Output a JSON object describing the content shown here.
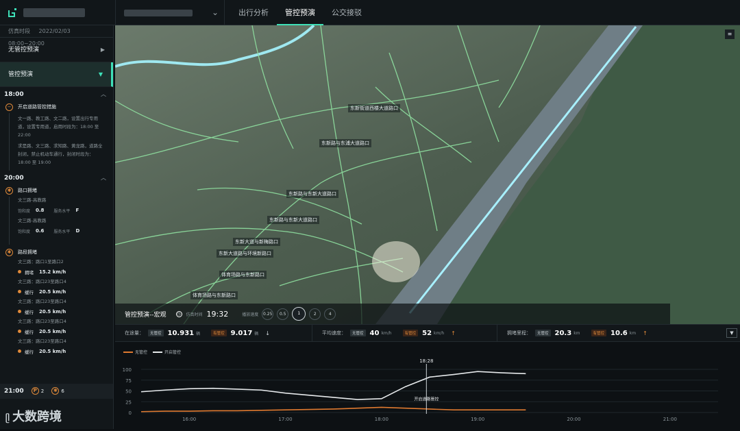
{
  "header": {
    "tabs": [
      {
        "label": "出行分析",
        "active": false
      },
      {
        "label": "管控预演",
        "active": true
      },
      {
        "label": "公交接驳",
        "active": false
      }
    ]
  },
  "sidebar": {
    "sim_label": "仿真时段",
    "sim_date": "2022/02/03",
    "sim_range": "08:00~20:00",
    "sections": [
      {
        "label": "无管控预演",
        "active": false
      },
      {
        "label": "管控预演",
        "active": true
      }
    ],
    "groups": [
      {
        "time": "18:00",
        "events": [
          {
            "title": "开启道路管控措施",
            "descs": [
              "文一路、教工路、文二路，设置出行专用道，设置专用道，启用时段为：18:00 至 22:00",
              "求是路、文三路、求知路、黄龙路，道路全封闭，禁止机动车通行，封闭时段为：18:00 至 19:00"
            ]
          }
        ]
      },
      {
        "time": "20:00",
        "junction": {
          "title": "路口拥堵",
          "rows": [
            {
              "name": "文三路-高教路",
              "k1": "饱和度",
              "v1": "0.8",
              "k2": "服务水平",
              "v2": "F"
            },
            {
              "name": "文三路-高教路",
              "k1": "饱和度",
              "v1": "0.6",
              "k2": "服务水平",
              "v2": "D"
            }
          ]
        },
        "road": {
          "title": "路段拥堵",
          "rows": [
            {
              "name": "文三路：路口1至路口2",
              "status": "拥堵",
              "speed": "15.2 km/h"
            },
            {
              "name": "文三路：路口23至路口4",
              "status": "缓行",
              "speed": "20.5 km/h"
            },
            {
              "name": "文三路：路口23至路口4",
              "status": "缓行",
              "speed": "20.5 km/h"
            },
            {
              "name": "文三路：路口23至路口4",
              "status": "缓行",
              "speed": "20.5 km/h"
            },
            {
              "name": "文三路：路口23至路口4",
              "status": "缓行",
              "speed": "20.5 km/h"
            }
          ]
        }
      }
    ],
    "bottom": {
      "time": "21:00",
      "b1": "2",
      "b2": "6"
    },
    "watermark": "大数跨境"
  },
  "map": {
    "labels": [
      "东新街道西楼大道路口",
      "东新路与东浦大道路口",
      "东新路与东新大道路口",
      "东新路与东新大道路口",
      "东新大道与新梅路口",
      "东新大道路与环境新路口",
      "体育场路与东新路口",
      "体育场路与东新路口"
    ]
  },
  "playbar": {
    "title": "管控预演--宏观",
    "time_label": "仿真时间",
    "time": "19:32",
    "speed_label": "播放速度",
    "speeds": [
      "0.25",
      "0.5",
      "1",
      "2",
      "4"
    ],
    "active_speed": "1"
  },
  "stats": {
    "volume": {
      "label": "在途量：",
      "tag1": "无管控",
      "v1": "10.931",
      "u1": "辆",
      "tag2": "有管控",
      "v2": "9.017",
      "u2": "辆",
      "trend": "↓"
    },
    "avg_speed": {
      "label": "平均速度：",
      "tag1": "无管控",
      "v1": "40",
      "u1": "km/h",
      "tag2": "有管控",
      "v2": "52",
      "u2": "km/h",
      "trend": "↑"
    },
    "congestion": {
      "label": "拥堵里程：",
      "tag1": "无管控",
      "v1": "20.3",
      "u1": "km",
      "tag2": "有管控",
      "v2": "10.6",
      "u2": "km",
      "trend": "↑"
    }
  },
  "chart_data": {
    "type": "line",
    "x": [
      "15:30",
      "15:45",
      "16:00",
      "16:15",
      "16:30",
      "16:45",
      "17:00",
      "17:15",
      "17:30",
      "17:45",
      "18:00",
      "18:15",
      "18:30",
      "18:45",
      "19:00",
      "19:15",
      "19:30"
    ],
    "xticks": [
      "16:00",
      "17:00",
      "18:00",
      "19:00",
      "20:00",
      "21:00"
    ],
    "yticks": [
      "0",
      "25",
      "50",
      "75",
      "100"
    ],
    "ylim": [
      0,
      100
    ],
    "series": [
      {
        "name": "无管控",
        "color": "#e07a30",
        "values": [
          2,
          3,
          3,
          4,
          4,
          5,
          6,
          7,
          8,
          10,
          12,
          10,
          8,
          6,
          6,
          6,
          6
        ]
      },
      {
        "name": "开启管控",
        "color": "#e6e9eb",
        "values": [
          48,
          52,
          55,
          56,
          54,
          52,
          45,
          40,
          35,
          30,
          32,
          60,
          82,
          88,
          95,
          92,
          90
        ]
      }
    ],
    "annotation": {
      "time": "18:28",
      "text": "开启道路管控"
    }
  }
}
